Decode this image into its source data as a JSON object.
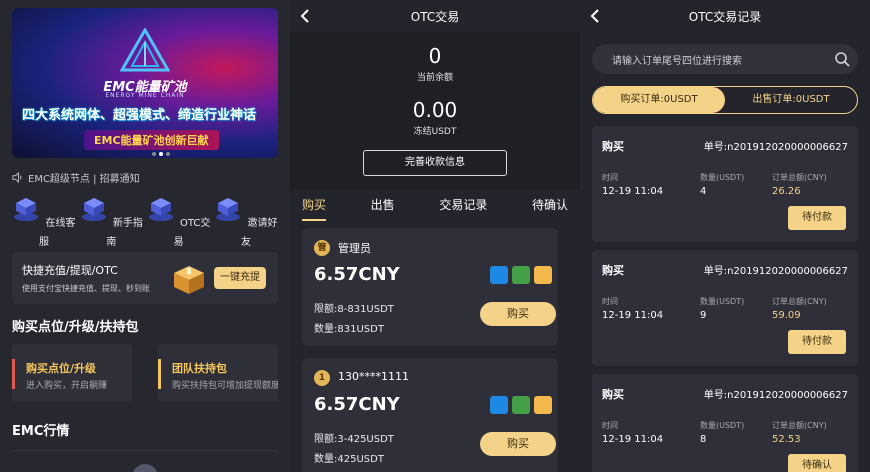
{
  "left": {
    "banner": {
      "logo_title": "EMC能量矿池",
      "logo_sub": "ENERGY MINE CHAIN",
      "slogan": "四大系统网体、超强模式、缔造行业神话",
      "badge": "EMC能量矿池创新巨献"
    },
    "notice": "EMC超级节点 |  招募通知",
    "quick": [
      {
        "label": "在线客服",
        "icon": "cube-icon"
      },
      {
        "label": "新手指南",
        "icon": "cube-icon"
      },
      {
        "label": "OTC交易",
        "icon": "cube-icon"
      },
      {
        "label": "邀请好友",
        "icon": "cube-icon"
      }
    ],
    "fast": {
      "title": "快捷充值/提现/OTC",
      "sub": "使用支付宝快捷充值、提现、秒到账",
      "button": "一键充提"
    },
    "section1": "购买点位/升级/扶持包",
    "packages": [
      {
        "title": "购买点位/升级",
        "sub": "进入购买，开启躺赚",
        "color": "#e05a4f"
      },
      {
        "title": "团队扶持包",
        "sub": "购买扶持包可增加提现额度",
        "color": "#f4c65b"
      }
    ],
    "section2": "EMC行情"
  },
  "otc": {
    "title": "OTC交易",
    "balance": {
      "value": "0",
      "label": "当前余额"
    },
    "frozen": {
      "value": "0.00",
      "label": "冻结USDT"
    },
    "complete_button": "完善收款信息",
    "tabs": [
      "购买",
      "出售",
      "交易记录",
      "待确认"
    ],
    "orders": [
      {
        "avatar": "管",
        "name": "管理员",
        "price": "6.57CNY",
        "limit": "限额:8-831USDT",
        "qty": "数量:831USDT",
        "button": "购买"
      },
      {
        "avatar": "1",
        "name": "130****1111",
        "price": "6.57CNY",
        "limit": "限额:3-425USDT",
        "qty": "数量:425USDT",
        "button": "购买"
      }
    ]
  },
  "records": {
    "title": "OTC交易记录",
    "search_placeholder": "请输入订单尾号四位进行搜索",
    "seg": {
      "buy": "购买订单:0USDT",
      "sell": "出售订单:0USDT"
    },
    "labels": {
      "time": "时间",
      "qty": "数量(USDT)",
      "total": "订单总额(CNY)"
    },
    "items": [
      {
        "type": "购买",
        "no": "单号:n201912020000006627",
        "time": "12-19 11:04",
        "qty": "4",
        "total": "26.26",
        "status": "待付款"
      },
      {
        "type": "购买",
        "no": "单号:n201912020000006627",
        "time": "12-19 11:04",
        "qty": "9",
        "total": "59.09",
        "status": "待付款"
      },
      {
        "type": "购买",
        "no": "单号:n201912020000006627",
        "time": "12-19 11:04",
        "qty": "8",
        "total": "52.53",
        "status": "待确认"
      }
    ]
  }
}
